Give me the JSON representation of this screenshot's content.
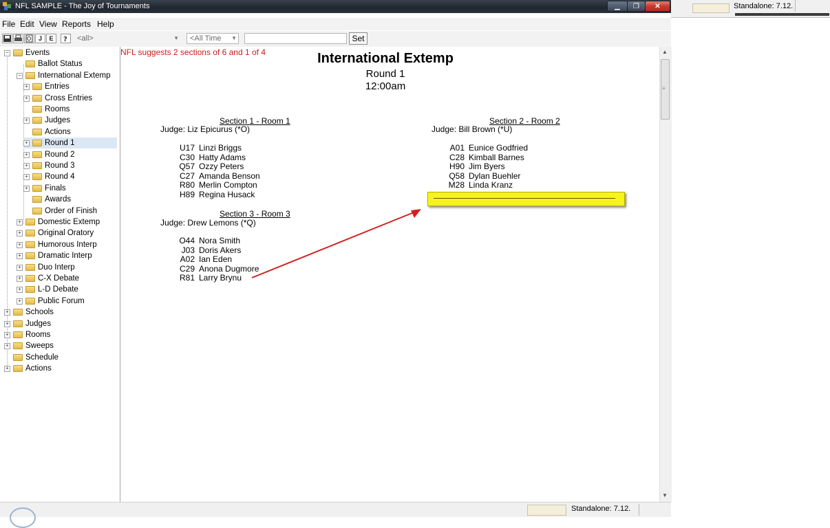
{
  "window": {
    "title": "NFL SAMPLE - The Joy of Tournaments"
  },
  "menu": [
    "File",
    "Edit",
    "View",
    "Reports",
    "Help"
  ],
  "toolbar": {
    "j_label": "J",
    "e_label": "E",
    "filter_all": "<all>",
    "time_filter": "<All Time",
    "set_label": "Set"
  },
  "tree": [
    {
      "label": "Events",
      "level": 0,
      "expander": "minus"
    },
    {
      "label": "Ballot Status",
      "level": 1,
      "expander": "none"
    },
    {
      "label": "International Extemp",
      "level": 1,
      "expander": "minus"
    },
    {
      "label": "Entries",
      "level": 2,
      "expander": "plus"
    },
    {
      "label": "Cross Entries",
      "level": 2,
      "expander": "plus"
    },
    {
      "label": "Rooms",
      "level": 2,
      "expander": "none"
    },
    {
      "label": "Judges",
      "level": 2,
      "expander": "plus"
    },
    {
      "label": "Actions",
      "level": 2,
      "expander": "none"
    },
    {
      "label": "Round 1",
      "level": 2,
      "expander": "plus",
      "selected": true
    },
    {
      "label": "Round 2",
      "level": 2,
      "expander": "plus"
    },
    {
      "label": "Round 3",
      "level": 2,
      "expander": "plus"
    },
    {
      "label": "Round 4",
      "level": 2,
      "expander": "plus"
    },
    {
      "label": "Finals",
      "level": 2,
      "expander": "plus"
    },
    {
      "label": "Awards",
      "level": 2,
      "expander": "none"
    },
    {
      "label": "Order of Finish",
      "level": 2,
      "expander": "none"
    },
    {
      "label": "Domestic Extemp",
      "level": 1,
      "expander": "plus"
    },
    {
      "label": "Original Oratory",
      "level": 1,
      "expander": "plus"
    },
    {
      "label": "Humorous Interp",
      "level": 1,
      "expander": "plus"
    },
    {
      "label": "Dramatic Interp",
      "level": 1,
      "expander": "plus"
    },
    {
      "label": "Duo Interp",
      "level": 1,
      "expander": "plus"
    },
    {
      "label": "C-X Debate",
      "level": 1,
      "expander": "plus"
    },
    {
      "label": "L-D Debate",
      "level": 1,
      "expander": "plus"
    },
    {
      "label": "Public Forum",
      "level": 1,
      "expander": "plus"
    },
    {
      "label": "Schools",
      "level": 0,
      "expander": "plus"
    },
    {
      "label": "Judges",
      "level": 0,
      "expander": "plus"
    },
    {
      "label": "Rooms",
      "level": 0,
      "expander": "plus"
    },
    {
      "label": "Sweeps",
      "level": 0,
      "expander": "plus"
    },
    {
      "label": "Schedule",
      "level": 0,
      "expander": "none"
    },
    {
      "label": "Actions",
      "level": 0,
      "expander": "plus"
    }
  ],
  "report": {
    "suggestion": "NFL suggests 2 sections of 6 and 1 of 4",
    "event_title": "International Extemp",
    "round": "Round 1",
    "time": "12:00am",
    "sections": [
      {
        "heading": "Section 1 - Room 1",
        "judge": "Judge:  Liz Epicurus (*O)",
        "entries": [
          {
            "code": "U17",
            "name": "Linzi Briggs"
          },
          {
            "code": "C30",
            "name": "Hatty Adams"
          },
          {
            "code": "Q57",
            "name": "Ozzy Peters"
          },
          {
            "code": "C27",
            "name": "Amanda Benson"
          },
          {
            "code": "R80",
            "name": "Merlin Compton"
          },
          {
            "code": "H89",
            "name": "Regina Husack"
          }
        ]
      },
      {
        "heading": "Section 2 - Room 2",
        "judge": "Judge:  Bill Brown (*U)",
        "entries": [
          {
            "code": "A01",
            "name": "Eunice Godfried"
          },
          {
            "code": "C28",
            "name": "Kimball Barnes"
          },
          {
            "code": "H90",
            "name": "Jim Byers"
          },
          {
            "code": "Q58",
            "name": "Dylan Buehler"
          },
          {
            "code": "M28",
            "name": "Linda Kranz"
          }
        ]
      },
      {
        "heading": "Section 3 - Room 3",
        "judge": "Judge:  Drew Lemons (*Q)",
        "entries": [
          {
            "code": "O44",
            "name": "Nora Smith"
          },
          {
            "code": "J03",
            "name": "Doris Akers"
          },
          {
            "code": "A02",
            "name": "Ian Eden"
          },
          {
            "code": "C29",
            "name": "Anona Dugmore"
          },
          {
            "code": "R81",
            "name": "Larry Brynu"
          }
        ]
      }
    ]
  },
  "status": {
    "version": "Standalone: 7.12."
  },
  "background_strip": {
    "version": "Standalone: 7.12."
  },
  "colors": {
    "suggestion": "#d01a1a",
    "drop_target": "#f7f31c",
    "arrow": "#d42020",
    "selected_node": "#dbe7f5"
  }
}
